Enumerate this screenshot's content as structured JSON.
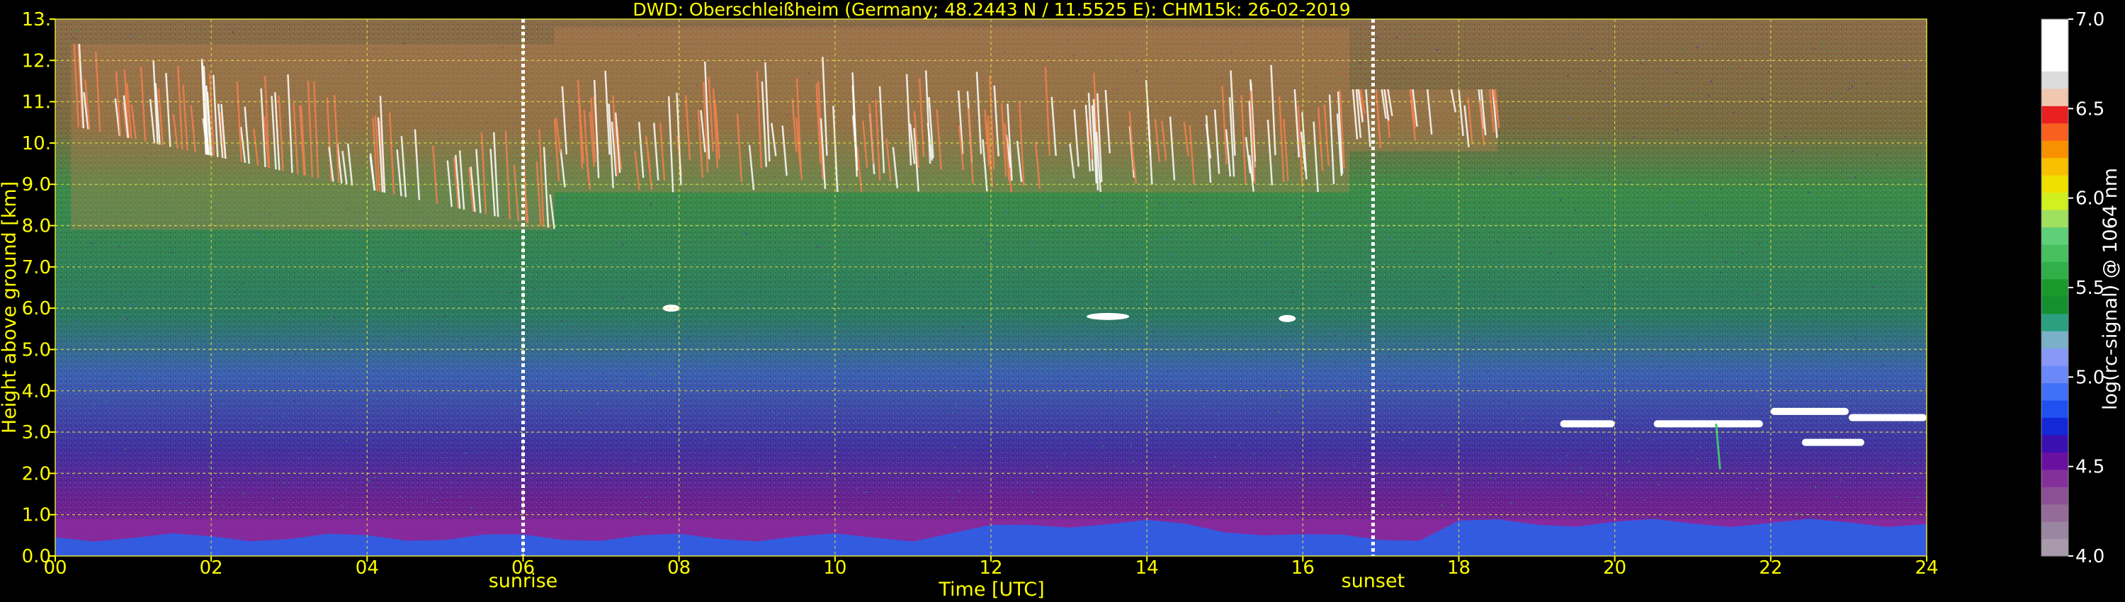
{
  "chart_data": {
    "type": "heatmap",
    "title": "DWD: Oberschleißheim (Germany; 48.2443 N / 11.5525 E):    CHM15k: 26-02-2019",
    "xlabel": "Time [UTC]",
    "ylabel": "Height above ground [km]",
    "xlim": [
      0,
      24
    ],
    "ylim": [
      0,
      13
    ],
    "x_ticks": [
      {
        "value": 0,
        "label": "00"
      },
      {
        "value": 2,
        "label": "02"
      },
      {
        "value": 4,
        "label": "04"
      },
      {
        "value": 6,
        "label": "06"
      },
      {
        "value": 8,
        "label": "08"
      },
      {
        "value": 10,
        "label": "10"
      },
      {
        "value": 12,
        "label": "12"
      },
      {
        "value": 14,
        "label": "14"
      },
      {
        "value": 16,
        "label": "16"
      },
      {
        "value": 18,
        "label": "18"
      },
      {
        "value": 20,
        "label": "20"
      },
      {
        "value": 22,
        "label": "22"
      },
      {
        "value": 24,
        "label": "24"
      }
    ],
    "y_ticks": [
      {
        "value": 0,
        "label": "0.0"
      },
      {
        "value": 1,
        "label": "1.0"
      },
      {
        "value": 2,
        "label": "2.0"
      },
      {
        "value": 3,
        "label": "3.0"
      },
      {
        "value": 4,
        "label": "4.0"
      },
      {
        "value": 5,
        "label": "5.0"
      },
      {
        "value": 6,
        "label": "6.0"
      },
      {
        "value": 7,
        "label": "7.0"
      },
      {
        "value": 8,
        "label": "8.0"
      },
      {
        "value": 9,
        "label": "9.0"
      },
      {
        "value": 10,
        "label": "10."
      },
      {
        "value": 11,
        "label": "11."
      },
      {
        "value": 12,
        "label": "12."
      },
      {
        "value": 13,
        "label": "13."
      }
    ],
    "grid": true,
    "events": [
      {
        "label": "sunrise",
        "x": 6.0
      },
      {
        "label": "sunset",
        "x": 16.9
      }
    ],
    "colorbar": {
      "label": "log(rc-signal) @ 1064 nm",
      "range": [
        4.0,
        7.0
      ],
      "ticks": [
        {
          "value": 4.0,
          "label": "4.0"
        },
        {
          "value": 4.5,
          "label": "4.5"
        },
        {
          "value": 5.0,
          "label": "5.0"
        },
        {
          "value": 5.5,
          "label": "5.5"
        },
        {
          "value": 6.0,
          "label": "6.0"
        },
        {
          "value": 6.5,
          "label": "6.5"
        },
        {
          "value": 7.0,
          "label": "7.0"
        }
      ],
      "colors": [
        "#a89aaa",
        "#9a86a0",
        "#956b98",
        "#8a4f94",
        "#84309a",
        "#6a10a0",
        "#3a10b0",
        "#1428d8",
        "#2050f0",
        "#4070f8",
        "#6a88f8",
        "#8898f8",
        "#7ab0c8",
        "#2aa080",
        "#149030",
        "#1a9a2a",
        "#30b048",
        "#48c060",
        "#60d078",
        "#a0e060",
        "#d0f020",
        "#f0e000",
        "#f8c000",
        "#f89000",
        "#f86020",
        "#e82020",
        "#f0c8b0",
        "#dcdcdc",
        "#ffffff",
        "#ffffff",
        "#ffffff"
      ]
    },
    "layers": {
      "boundary_layer": {
        "height_km": [
          0.0,
          0.9
        ],
        "color": "#8a2aa0"
      },
      "low_signal_band": {
        "height_km": [
          0.0,
          0.45
        ],
        "color": "#2a60e8"
      },
      "noise_field_colors": [
        "#20a050",
        "#3070e0",
        "#6020a0"
      ],
      "cirrus_segments": [
        {
          "t_start": 0.2,
          "t_end": 6.4,
          "h_low": 7.9,
          "h_high": 12.4
        },
        {
          "t_start": 6.4,
          "t_end": 16.6,
          "h_low": 8.8,
          "h_high": 12.8
        },
        {
          "t_start": 16.6,
          "t_end": 18.5,
          "h_low": 9.8,
          "h_high": 11.3
        }
      ],
      "small_clouds": [
        {
          "t": 7.9,
          "h": 6.0
        },
        {
          "t": 13.5,
          "h": 5.8
        },
        {
          "t": 15.8,
          "h": 5.75
        }
      ],
      "low_clouds": [
        {
          "t_start": 19.3,
          "t_end": 20.0,
          "h": 3.2
        },
        {
          "t_start": 20.5,
          "t_end": 21.9,
          "h": 3.2
        },
        {
          "t_start": 22.0,
          "t_end": 23.0,
          "h": 3.5
        },
        {
          "t_start": 23.0,
          "t_end": 24.0,
          "h": 3.35
        },
        {
          "t_start": 22.4,
          "t_end": 23.2,
          "h": 2.75
        }
      ]
    }
  }
}
